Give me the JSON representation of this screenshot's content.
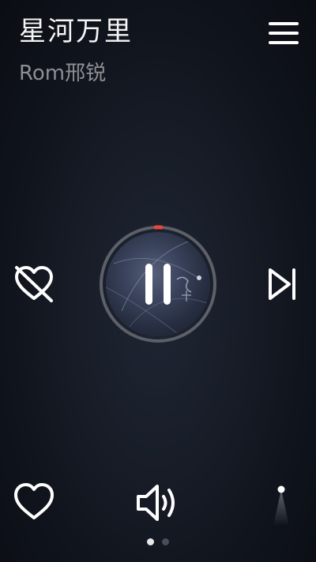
{
  "song": {
    "title": "星河万里",
    "artist": "Rom邢锐"
  },
  "player": {
    "state": "playing",
    "accent_color": "#e8453c",
    "ring_color": "#5d6068"
  },
  "controls": {
    "menu_icon": "hamburger-menu-icon",
    "dislike_icon": "heart-crossed-icon",
    "pause_icon": "pause-icon",
    "next_icon": "skip-next-icon",
    "favorite_icon": "heart-outline-icon",
    "volume_icon": "speaker-volume-icon"
  },
  "pager": {
    "page_count": 2,
    "current_page": 1
  }
}
